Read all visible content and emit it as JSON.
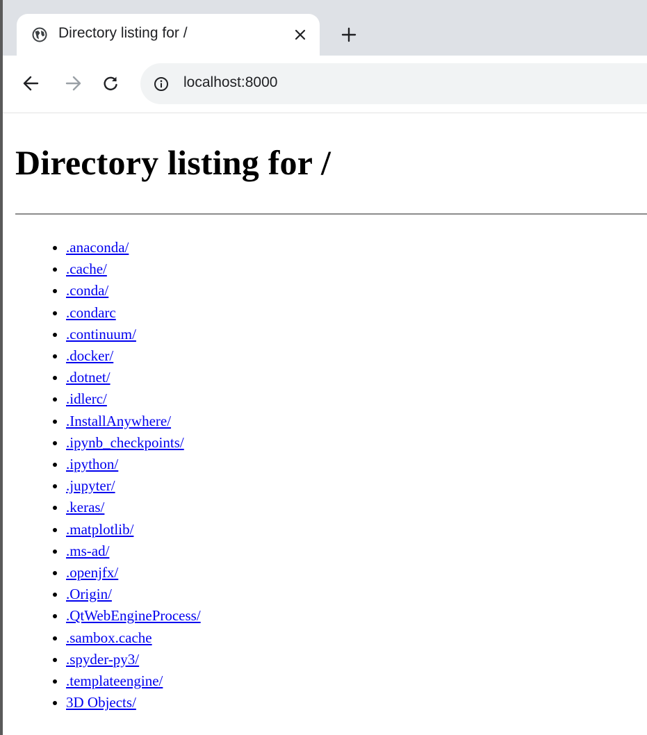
{
  "browser": {
    "tab": {
      "title": "Directory listing for /"
    },
    "address_bar": {
      "url": "localhost:8000"
    }
  },
  "page": {
    "heading": "Directory listing for /",
    "entries": [
      ".anaconda/",
      ".cache/",
      ".conda/",
      ".condarc",
      ".continuum/",
      ".docker/",
      ".dotnet/",
      ".idlerc/",
      ".InstallAnywhere/",
      ".ipynb_checkpoints/",
      ".ipython/",
      ".jupyter/",
      ".keras/",
      ".matplotlib/",
      ".ms-ad/",
      ".openjfx/",
      ".Origin/",
      ".QtWebEngineProcess/",
      ".sambox.cache",
      ".spyder-py3/",
      ".templateengine/",
      "3D Objects/"
    ]
  },
  "icons": {
    "tab_icon": "globe-icon",
    "tab_close": "close-icon",
    "new_tab": "plus-icon",
    "back": "arrow-left-icon",
    "forward": "arrow-right-icon",
    "reload": "reload-icon",
    "site_info": "info-icon"
  },
  "colors": {
    "tabstrip": "#dee1e6",
    "omnibox": "#f1f3f4",
    "link": "#0000ee"
  }
}
